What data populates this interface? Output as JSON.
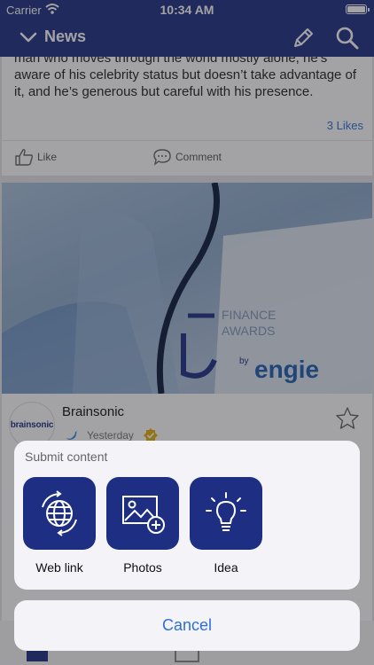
{
  "status": {
    "carrier": "Carrier",
    "time": "10:34 AM"
  },
  "nav": {
    "title": "News"
  },
  "post1": {
    "text": "man who moves through the world mostly alone, he’s aware of his celebrity status but doesn’t take advantage of it, and he’s generous but careful with his presence.",
    "likes": "3 Likes",
    "like_label": "Like",
    "comment_label": "Comment"
  },
  "post2": {
    "photo_caption": [
      "FINANCE",
      "AWARDS"
    ],
    "photo_brand": "engie",
    "photo_by": "by",
    "author": "Brainsonic",
    "author_logo": "brainsonic",
    "time": "Yesterday"
  },
  "sheet": {
    "title": "Submit content",
    "options": [
      {
        "label": "Web link",
        "icon": "globe-refresh-icon"
      },
      {
        "label": "Photos",
        "icon": "image-add-icon"
      },
      {
        "label": "Idea",
        "icon": "lightbulb-icon"
      }
    ],
    "cancel": "Cancel"
  },
  "colors": {
    "brand": "#1e2f83",
    "link": "#2e6fd7",
    "verified": "#e3b007"
  }
}
